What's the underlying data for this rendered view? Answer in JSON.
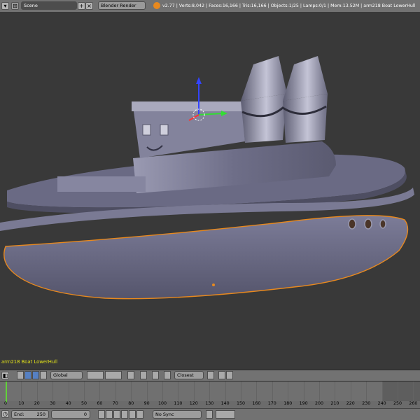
{
  "header": {
    "scene_name": "Scene",
    "render_engine": "Blender Render",
    "stats": "v2.77 | Verts:8,042 | Faces:16,166 | Tris:16,166 | Objects:1/25 | Lamps:0/1 | Mem:13.52M | arm218 Boat LowerHull",
    "icons": [
      "editor-type-icon",
      "scene-browse-icon",
      "add-scene-icon",
      "remove-scene-icon",
      "blender-logo-icon"
    ]
  },
  "viewport": {
    "active_object_label": "arm218 Boat LowerHull",
    "colors": {
      "background": "#393939",
      "selection_outline": "#e8891e",
      "hull": "#6e6e8a",
      "gizmo_x": "#ff3333",
      "gizmo_y": "#33dd33",
      "gizmo_z": "#3344ff"
    }
  },
  "toolbar3d": {
    "orientation": "Global",
    "snap_target": "Closest"
  },
  "timeline": {
    "current_frame_marker": 1,
    "tick_labels": [
      "0",
      "10",
      "20",
      "30",
      "40",
      "50",
      "60",
      "70",
      "80",
      "90",
      "100",
      "110",
      "120",
      "130",
      "140",
      "150",
      "160",
      "170",
      "180",
      "190",
      "200",
      "210",
      "220",
      "230",
      "240",
      "250",
      "260",
      "270"
    ],
    "playback_range_end": 250
  },
  "footer": {
    "end_label": "End:",
    "end_value": "250",
    "current_frame_value": "0",
    "sync_mode": "No Sync"
  }
}
